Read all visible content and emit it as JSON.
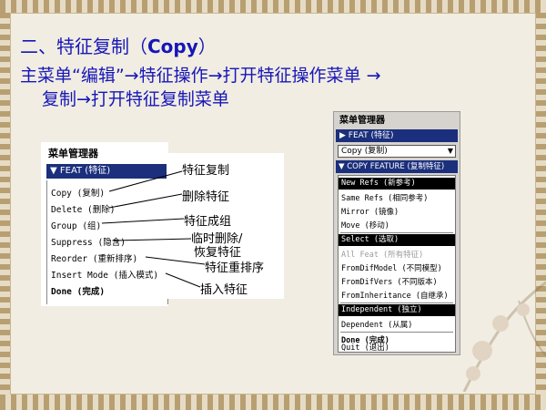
{
  "slide": {
    "title_prefix": "二、特征复制（",
    "title_bold": "Copy",
    "title_suffix": "）",
    "line1": "主菜单“编辑”→特征操作→打开特征操作菜单 →",
    "line2": "复制→打开特征复制菜单"
  },
  "left_menu": {
    "header": "菜单管理器",
    "feat_bar": "▼ FEAT (特征)",
    "items": [
      "Copy (复制)",
      "Delete (删除)",
      "Group (组)",
      "Suppress (隐含)",
      "Reorder (重新排序)",
      "Insert Mode (插入模式)",
      "Done (完成)"
    ]
  },
  "callouts": [
    "特征复制",
    "删除特征",
    "特征成组",
    "临时删除/",
    "恢复特征",
    "特征重排序",
    "插入特征"
  ],
  "right_menu": {
    "header": "菜单管理器",
    "feat_bar": "▶ FEAT (特征)",
    "select_value": "Copy (复制)",
    "copy_feature_bar": "▼ COPY FEATURE (复制特征)",
    "group1": [
      "New Refs (新参考)",
      "Same Refs (相同参考)",
      "Mirror (镜像)",
      "Move (移动)"
    ],
    "group2": [
      "Select (选取)",
      "All Feat (所有特征)",
      "FromDifModel (不同模型)",
      "FromDifVers (不同版本)",
      "FromInheritance (自继承)"
    ],
    "group3": [
      "Independent (独立)",
      "Dependent (从属)"
    ],
    "done": "Done (完成)",
    "quit": "Quit (退出)"
  },
  "colors": {
    "heading": "#1616b8",
    "menu_bar": "#1b2f7c"
  }
}
